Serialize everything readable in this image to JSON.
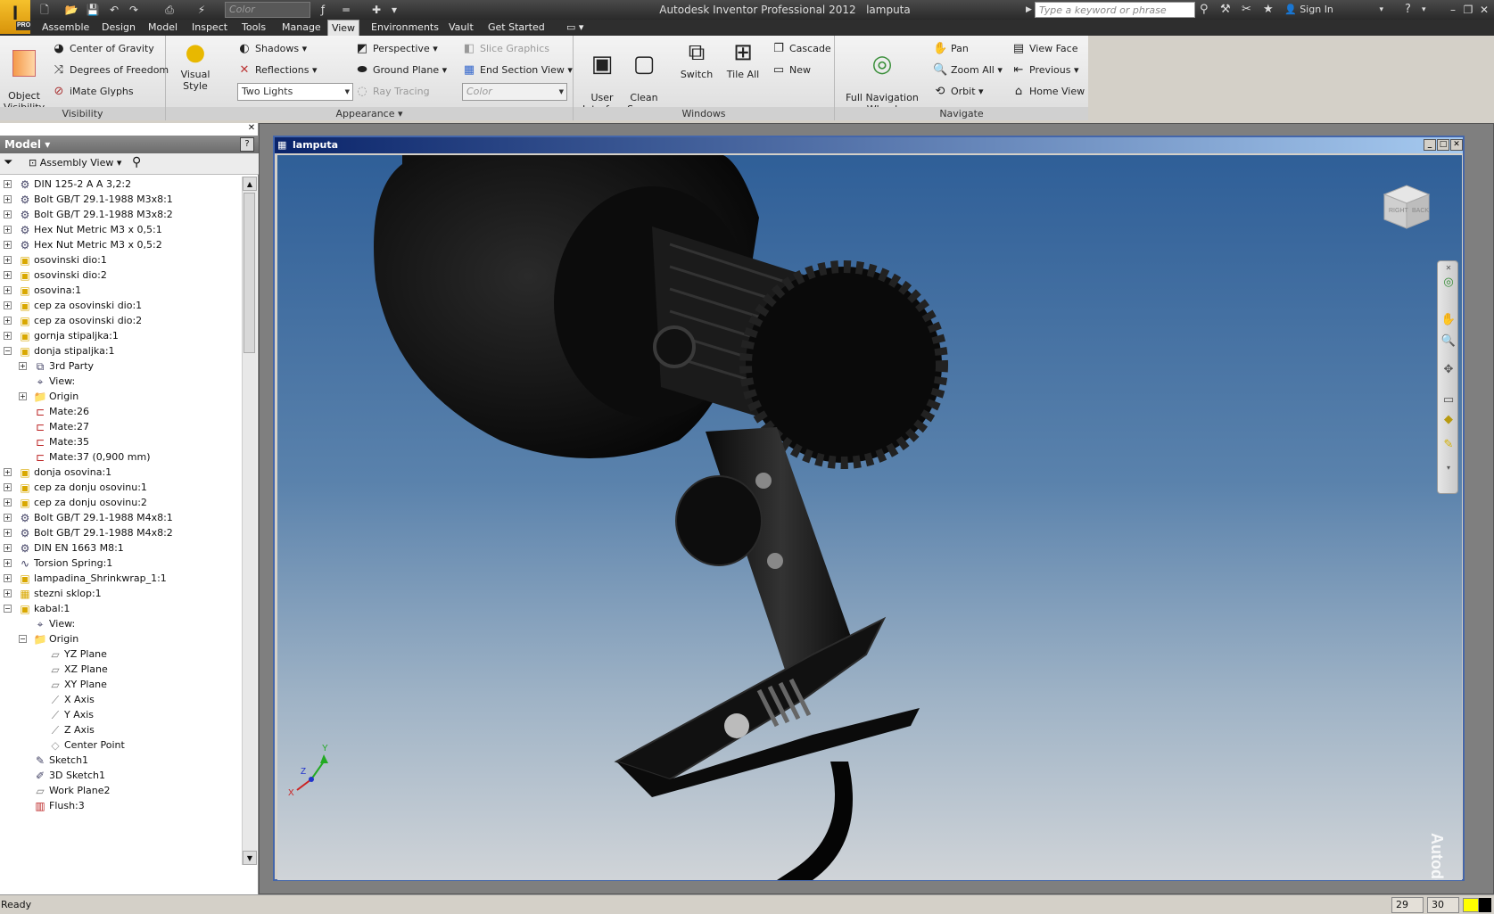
{
  "app": {
    "title": "Autodesk Inventor Professional 2012",
    "document": "lamputa",
    "logo_letter": "I",
    "logo_badge": "PRO",
    "search_placeholder": "Type a keyword or phrase",
    "sign_in": "Sign In",
    "quick_access_color": "Color"
  },
  "menu_tabs": [
    "Assemble",
    "Design",
    "Model",
    "Inspect",
    "Tools",
    "Manage",
    "View",
    "Environments",
    "Vault",
    "Get Started"
  ],
  "active_tab": "View",
  "ribbon": {
    "visibility": {
      "title": "Visibility",
      "object_visibility": "Object\nVisibility",
      "center_of_gravity": "Center of Gravity",
      "degrees_of_freedom": "Degrees of Freedom",
      "imate_glyphs": "iMate Glyphs"
    },
    "appearance": {
      "title": "Appearance",
      "visual_style": "Visual Style",
      "shadows": "Shadows",
      "reflections": "Reflections",
      "lighting": "Two Lights",
      "perspective": "Perspective",
      "ground_plane": "Ground Plane",
      "ray_tracing": "Ray Tracing",
      "slice_graphics": "Slice Graphics",
      "end_section_view": "End Section View",
      "color": "Color"
    },
    "windows": {
      "title": "Windows",
      "user_interface": "User\nInterface",
      "clean_screen": "Clean\nScreen",
      "switch": "Switch",
      "tile_all": "Tile All",
      "cascade": "Cascade",
      "new": "New"
    },
    "navigate": {
      "title": "Navigate",
      "full_nav_wheel": "Full Navigation\nWheel",
      "pan": "Pan",
      "zoom_all": "Zoom All",
      "orbit": "Orbit",
      "view_face": "View Face",
      "previous": "Previous",
      "home_view": "Home View"
    }
  },
  "browser": {
    "title": "Model",
    "view_mode": "Assembly View",
    "tree": [
      {
        "label": "DIN 125-2 A A 3,2:2",
        "level": 0,
        "icon": "part-icon",
        "exp": "+"
      },
      {
        "label": "Bolt GB/T 29.1-1988 M3x8:1",
        "level": 0,
        "icon": "part-icon",
        "exp": "+"
      },
      {
        "label": "Bolt GB/T 29.1-1988 M3x8:2",
        "level": 0,
        "icon": "part-icon",
        "exp": "+"
      },
      {
        "label": "Hex Nut Metric M3 x 0,5:1",
        "level": 0,
        "icon": "part-icon",
        "exp": "+"
      },
      {
        "label": "Hex Nut Metric M3 x 0,5:2",
        "level": 0,
        "icon": "part-icon",
        "exp": "+"
      },
      {
        "label": "osovinski dio:1",
        "level": 0,
        "icon": "component-icon",
        "exp": "+"
      },
      {
        "label": "osovinski dio:2",
        "level": 0,
        "icon": "component-icon",
        "exp": "+"
      },
      {
        "label": "osovina:1",
        "level": 0,
        "icon": "component-icon",
        "exp": "+"
      },
      {
        "label": "cep za osovinski dio:1",
        "level": 0,
        "icon": "component-icon",
        "exp": "+"
      },
      {
        "label": "cep za osovinski dio:2",
        "level": 0,
        "icon": "component-icon",
        "exp": "+"
      },
      {
        "label": "gornja stipaljka:1",
        "level": 0,
        "icon": "component-icon",
        "exp": "+"
      },
      {
        "label": "donja stipaljka:1",
        "level": 0,
        "icon": "component-icon",
        "exp": "-"
      },
      {
        "label": "3rd Party",
        "level": 1,
        "icon": "third-party-icon",
        "exp": "+"
      },
      {
        "label": "View:",
        "level": 1,
        "icon": "view-icon",
        "exp": ""
      },
      {
        "label": "Origin",
        "level": 1,
        "icon": "folder-icon",
        "exp": "+"
      },
      {
        "label": "Mate:26",
        "level": 1,
        "icon": "mate-icon",
        "exp": ""
      },
      {
        "label": "Mate:27",
        "level": 1,
        "icon": "mate-icon",
        "exp": ""
      },
      {
        "label": "Mate:35",
        "level": 1,
        "icon": "mate-icon",
        "exp": ""
      },
      {
        "label": "Mate:37 (0,900 mm)",
        "level": 1,
        "icon": "mate-icon",
        "exp": ""
      },
      {
        "label": "donja osovina:1",
        "level": 0,
        "icon": "component-icon",
        "exp": "+"
      },
      {
        "label": "cep za donju osovinu:1",
        "level": 0,
        "icon": "component-icon",
        "exp": "+"
      },
      {
        "label": "cep za donju osovinu:2",
        "level": 0,
        "icon": "component-icon",
        "exp": "+"
      },
      {
        "label": "Bolt GB/T 29.1-1988 M4x8:1",
        "level": 0,
        "icon": "part-icon",
        "exp": "+"
      },
      {
        "label": "Bolt GB/T 29.1-1988 M4x8:2",
        "level": 0,
        "icon": "part-icon",
        "exp": "+"
      },
      {
        "label": "DIN EN 1663 M8:1",
        "level": 0,
        "icon": "part-icon",
        "exp": "+"
      },
      {
        "label": "Torsion Spring:1",
        "level": 0,
        "icon": "spring-icon",
        "exp": "+"
      },
      {
        "label": "lampadina_Shrinkwrap_1:1",
        "level": 0,
        "icon": "component-icon",
        "exp": "+"
      },
      {
        "label": "stezni sklop:1",
        "level": 0,
        "icon": "subassembly-icon",
        "exp": "+"
      },
      {
        "label": "kabal:1",
        "level": 0,
        "icon": "component-icon",
        "exp": "-"
      },
      {
        "label": "View:",
        "level": 1,
        "icon": "view-icon",
        "exp": ""
      },
      {
        "label": "Origin",
        "level": 1,
        "icon": "folder-icon",
        "exp": "-"
      },
      {
        "label": "YZ Plane",
        "level": 2,
        "icon": "plane-icon",
        "exp": ""
      },
      {
        "label": "XZ Plane",
        "level": 2,
        "icon": "plane-icon",
        "exp": ""
      },
      {
        "label": "XY Plane",
        "level": 2,
        "icon": "plane-icon",
        "exp": ""
      },
      {
        "label": "X Axis",
        "level": 2,
        "icon": "axis-icon",
        "exp": ""
      },
      {
        "label": "Y Axis",
        "level": 2,
        "icon": "axis-icon",
        "exp": ""
      },
      {
        "label": "Z Axis",
        "level": 2,
        "icon": "axis-icon",
        "exp": ""
      },
      {
        "label": "Center Point",
        "level": 2,
        "icon": "point-icon",
        "exp": ""
      },
      {
        "label": "Sketch1",
        "level": 1,
        "icon": "sketch-icon",
        "exp": ""
      },
      {
        "label": "3D Sketch1",
        "level": 1,
        "icon": "sketch3d-icon",
        "exp": ""
      },
      {
        "label": "Work Plane2",
        "level": 1,
        "icon": "plane-icon",
        "exp": ""
      },
      {
        "label": "Flush:3",
        "level": 1,
        "icon": "flush-icon",
        "exp": ""
      }
    ]
  },
  "graphics": {
    "window_title": "lamputa",
    "viewcube_right": "RIGHT",
    "viewcube_back": "BACK",
    "watermark": "Autodesk",
    "triad": {
      "x": "X",
      "y": "Y",
      "z": "Z"
    },
    "colors": {
      "x": "#cc2222",
      "y": "#22aa22",
      "z": "#2233cc"
    }
  },
  "status": {
    "text": "Ready",
    "occurrences": "29",
    "open_docs": "30"
  }
}
